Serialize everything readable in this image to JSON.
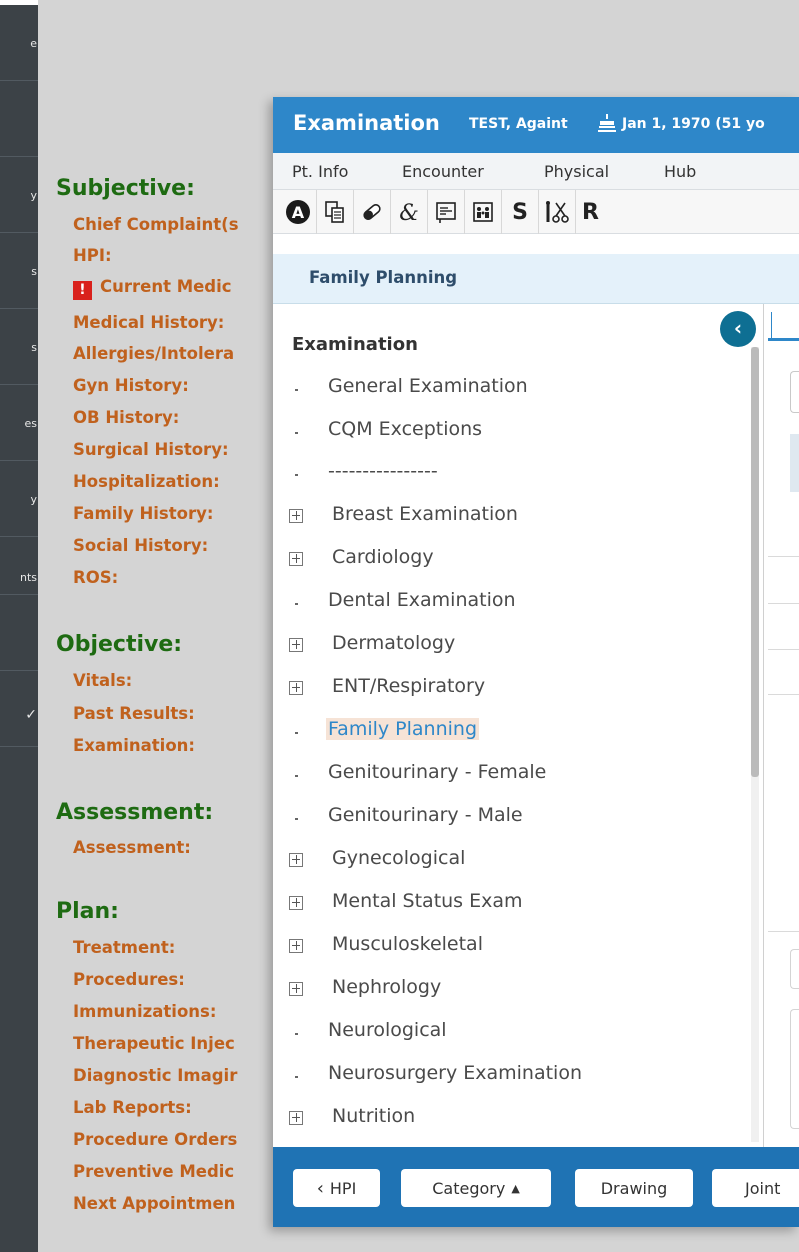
{
  "sidebar": {
    "items": [
      {
        "label": "e"
      },
      {
        "label": "y"
      },
      {
        "label": "s"
      },
      {
        "label": "s"
      },
      {
        "label": "es"
      },
      {
        "label": "y"
      },
      {
        "label": "nts"
      },
      {
        "label": "✓"
      }
    ]
  },
  "soap": {
    "sections": [
      {
        "title": "Subjective:",
        "items": [
          "Chief Complaint(s",
          "HPI:",
          "Current Medic",
          "Medical History:",
          "Allergies/Intolera",
          "Gyn History:",
          "OB History:",
          "Surgical History:",
          "Hospitalization:",
          "Family History:",
          "Social History:",
          "ROS:"
        ]
      },
      {
        "title": "Objective:",
        "items": [
          "Vitals:",
          "Past Results:",
          "Examination:"
        ]
      },
      {
        "title": "Assessment:",
        "items": [
          "Assessment:"
        ]
      },
      {
        "title": "Plan:",
        "items": [
          "Treatment:",
          "Procedures:",
          "Immunizations:",
          "Therapeutic Injec",
          "Diagnostic Imagir",
          "Lab Reports:",
          "Procedure Orders",
          "Preventive Medic",
          "Next Appointmen"
        ]
      }
    ],
    "alert_icon": "!"
  },
  "modal": {
    "title": "Examination",
    "patient": "TEST, Againt",
    "dob": "Jan 1, 1970 (51 yo",
    "menu": [
      "Pt. Info",
      "Encounter",
      "Physical",
      "Hub"
    ],
    "toolbar": {
      "icons": [
        "a-circle-icon",
        "copy-docs-icon",
        "pill-icon",
        "ampersand-icon",
        "form-icon",
        "family-icon"
      ],
      "text_buttons": [
        "S",
        "R"
      ]
    },
    "breadcrumb": "Family Planning",
    "tree": {
      "heading": "Examination",
      "items": [
        {
          "label": "General Examination",
          "expandable": false
        },
        {
          "label": "CQM Exceptions",
          "expandable": false
        },
        {
          "label": "----------------",
          "expandable": false
        },
        {
          "label": "Breast Examination",
          "expandable": true
        },
        {
          "label": "Cardiology",
          "expandable": true
        },
        {
          "label": "Dental Examination",
          "expandable": false
        },
        {
          "label": "Dermatology",
          "expandable": true
        },
        {
          "label": "ENT/Respiratory",
          "expandable": true
        },
        {
          "label": "Family Planning",
          "expandable": false,
          "selected": true
        },
        {
          "label": "Genitourinary - Female",
          "expandable": false
        },
        {
          "label": "Genitourinary - Male",
          "expandable": false
        },
        {
          "label": "Gynecological",
          "expandable": true
        },
        {
          "label": "Mental Status Exam",
          "expandable": true
        },
        {
          "label": "Musculoskeletal",
          "expandable": true
        },
        {
          "label": "Nephrology",
          "expandable": true
        },
        {
          "label": "Neurological",
          "expandable": false
        },
        {
          "label": "Neurosurgery Examination",
          "expandable": false
        },
        {
          "label": "Nutrition",
          "expandable": true
        }
      ]
    },
    "collapse_icon": "‹",
    "footer": {
      "hpi": "HPI",
      "category": "Category",
      "drawing": "Drawing",
      "joint": "Joint"
    }
  },
  "colors": {
    "titlebar": "#2e87c9",
    "footer": "#1f73b4",
    "section": "#1e6b12",
    "item": "#c0611d",
    "selected_bg": "#f6e3d6"
  }
}
